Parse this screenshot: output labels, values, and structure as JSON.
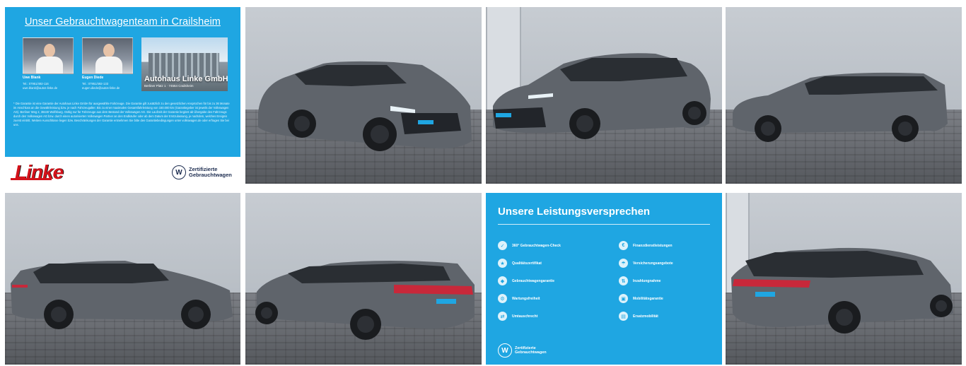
{
  "info_tile_1": {
    "title": "Unser Gebrauchtwagenteam in Crailsheim",
    "people": [
      {
        "name": "Uwe Blank",
        "phone": "Tel.: 07951/492-116",
        "email": "uwe.blank@autos-linke.de"
      },
      {
        "name": "Eugen Diede",
        "phone": "Tel.: 07951/492-133",
        "email": "eugen.diede@autos-linke.de"
      }
    ],
    "dealer_name": "Autohaus Linke GmbH",
    "dealer_address": "Berliner Platz 1 · 74564 Crailsheim",
    "legal_text": "* Die Garantie ist eine Garantie der Autohaus Linke GmbH für ausgewählte Fahrzeuge. Die Garantie gilt zusätzlich zu den gesetzlichen Ansprüchen für bis zu 36 Monate im Anschluss an die Gewährleistung bzw. je nach Fahrzeugalter. Bis zu einer maximalen Gesamtfahrleistung von 150.000 km (Garantiegeber ist jeweils der Volkswagen AG). Berliner Weg 2, 38440 Wolfsburg. Gültig nur für Fahrzeuge aus dem Bestand der Volkswagen AG. Die Laufzeit der Garantie beginnt ab Übergabe des Fahrzeugs durch den Volkswagen AG bzw. durch einen autorisierten Volkswagen Partner an den Endkäufer oder ab dem Datum der Erstzulassung, je nachdem, welches Ereignis zuerst eintritt. Weitere Ausschlüsse liegen bzw. Beschränkungen der Garantie entnehmen Sie bitte den Garantiebedingungen unter volkswagen.de oder erfragen Sie bei uns.",
    "logo_text": "Linke",
    "badge_line1": "Zertifizierte",
    "badge_line2": "Gebrauchtwagen"
  },
  "info_tile_7": {
    "heading": "Unsere Leistungsversprechen",
    "services_left": [
      "360° Gebrauchtwagen-Check",
      "Qualitätszertifikat",
      "Gebrauchtwagengarantie",
      "Wartungsfreiheit",
      "Umtauschrecht"
    ],
    "services_right": [
      "Finanzdienstleistungen",
      "Versicherungsangebote",
      "Inzahlungnahme",
      "Mobilitätsgarantie",
      "Ersatzmobilität"
    ],
    "badge_line1": "Zertifizierte",
    "badge_line2": "Gebrauchtwagen"
  },
  "colors": {
    "vw_blue": "#1fa6e2",
    "linke_red": "#d3121a",
    "car_grey": "#5f646b"
  },
  "photos": [
    "front-left-view",
    "front-right-view",
    "side-left-view",
    "side-left-rear-view",
    "rear-left-view",
    "rear-right-view"
  ]
}
